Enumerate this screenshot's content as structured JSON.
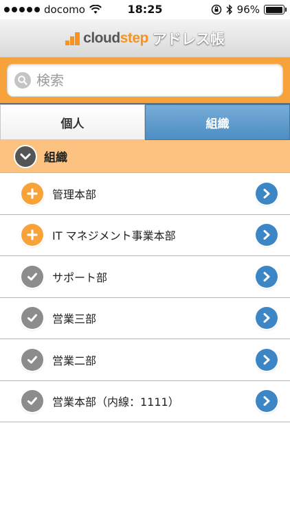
{
  "status_bar": {
    "carrier": "docomo",
    "time": "18:25",
    "battery": "96%",
    "battery_level": 0.96,
    "signal_bars": 5
  },
  "nav": {
    "logo_cloud": "cloud",
    "logo_step": "step",
    "title": "アドレス帳"
  },
  "search": {
    "placeholder": "検索",
    "value": ""
  },
  "tabs": [
    {
      "label": "個人",
      "active": false
    },
    {
      "label": "組織",
      "active": true
    }
  ],
  "section": {
    "title": "組織"
  },
  "list": [
    {
      "label": "管理本部",
      "icon": "plus-icon"
    },
    {
      "label": "IT マネジメント事業本部",
      "icon": "plus-icon"
    },
    {
      "label": "サポート部",
      "icon": "check-icon"
    },
    {
      "label": "営業三部",
      "icon": "check-icon"
    },
    {
      "label": "営業二部",
      "icon": "check-icon"
    },
    {
      "label": "営業本部（内線：1111）",
      "icon": "check-icon"
    }
  ],
  "colors": {
    "accent_orange": "#f8a23b",
    "section_orange": "#fcc280",
    "tab_active_blue": "#4d8ec4",
    "arrow_blue": "#3d86c6",
    "check_gray": "#8c8c8c"
  }
}
